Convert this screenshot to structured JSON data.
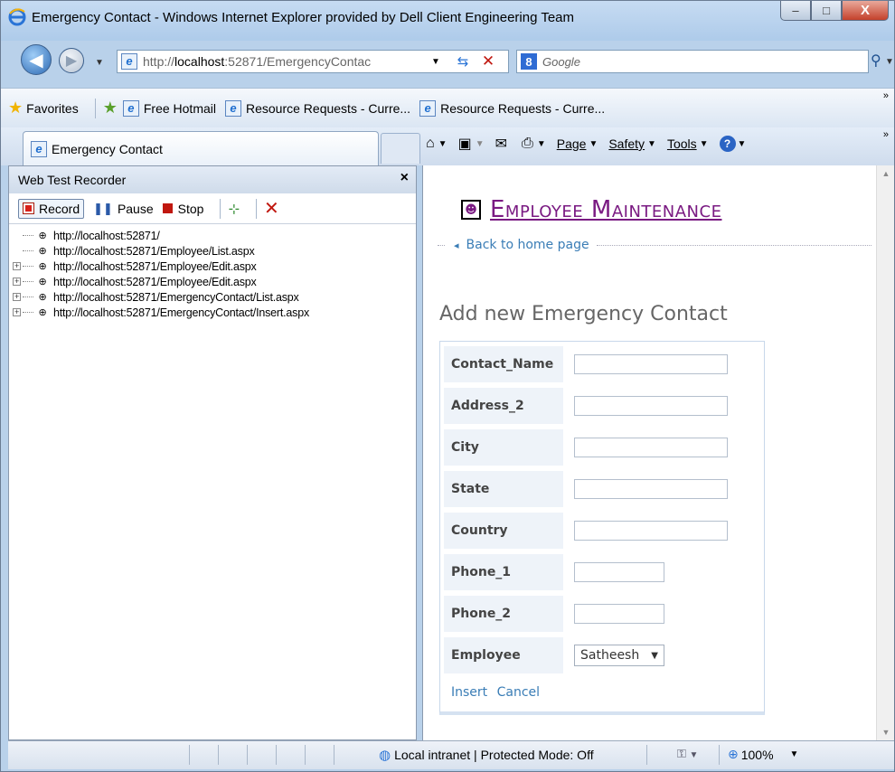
{
  "window": {
    "title": "Emergency Contact - Windows Internet Explorer provided by Dell Client Engineering Team",
    "minimize": "–",
    "maximize": "□",
    "close": "X"
  },
  "address": {
    "url_prefix": "http://",
    "url_host": "localhost",
    "url_rest": ":52871/EmergencyContac",
    "search_placeholder": "Google"
  },
  "favorites_bar": {
    "favorites_label": "Favorites",
    "items": [
      "Free Hotmail",
      "Resource Requests - Curre...",
      "Resource Requests - Curre..."
    ]
  },
  "tab": {
    "label": "Emergency Contact"
  },
  "command_bar": {
    "page": "Page",
    "safety": "Safety",
    "tools": "Tools"
  },
  "recorder": {
    "title": "Web Test Recorder",
    "record": "Record",
    "pause": "Pause",
    "stop": "Stop",
    "requests": [
      "http://localhost:52871/",
      "http://localhost:52871/Employee/List.aspx",
      "http://localhost:52871/Employee/Edit.aspx",
      "http://localhost:52871/Employee/Edit.aspx",
      "http://localhost:52871/EmergencyContact/List.aspx",
      "http://localhost:52871/EmergencyContact/Insert.aspx"
    ]
  },
  "page": {
    "heading": "Employee Maintenance",
    "back_link": "Back to home page",
    "form_title": "Add new Emergency Contact",
    "fields": [
      "Contact_Name",
      "Address_2",
      "City",
      "State",
      "Country",
      "Phone_1",
      "Phone_2",
      "Employee"
    ],
    "employee_selected": "Satheesh",
    "insert": "Insert",
    "cancel": "Cancel"
  },
  "status": {
    "zone": "Local intranet | Protected Mode: Off",
    "zoom": "100%"
  }
}
